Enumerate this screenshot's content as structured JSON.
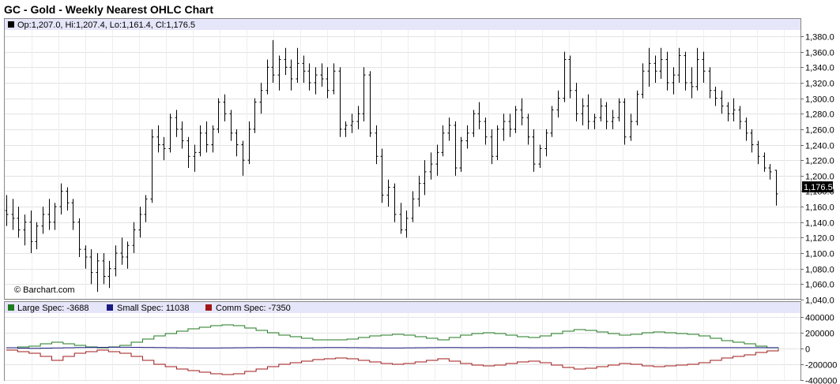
{
  "page_title": "GC - Gold - Weekly Nearest OHLC Chart",
  "colors": {
    "panel_border": "#888888",
    "info_strip": "#e6e6fa",
    "grid": "#e0e0e0",
    "bar": "#000000",
    "large_spec": "#1f7a1f",
    "small_spec": "#1a1a80",
    "comm_spec": "#a01818"
  },
  "chart_data": [
    {
      "type": "ohlc",
      "title": "GC - Gold - Weekly Nearest OHLC Chart",
      "info_line": "Op:1,207.0, Hi:1,207.4, Lo:1,161.4, Cl:1,176.5",
      "last_price_label": "1,176.5",
      "last_price": 1176.5,
      "watermark": "© Barchart.com",
      "ylim": [
        1040,
        1380
      ],
      "yticks": [
        1040,
        1060,
        1080,
        1100,
        1120,
        1140,
        1160,
        1180,
        1200,
        1220,
        1240,
        1260,
        1280,
        1300,
        1320,
        1340,
        1360,
        1380
      ],
      "ytick_labels": [
        "1,040.0",
        "1,060.0",
        "1,080.0",
        "1,100.0",
        "1,120.0",
        "1,140.0",
        "1,160.0",
        "1,180.0",
        "1,200.0",
        "1,220.0",
        "1,240.0",
        "1,260.0",
        "1,280.0",
        "1,300.0",
        "1,320.0",
        "1,340.0",
        "1,360.0",
        "1,380.0"
      ],
      "grid": true,
      "bars": [
        [
          1155,
          1175,
          1135,
          1150
        ],
        [
          1150,
          1170,
          1130,
          1145
        ],
        [
          1145,
          1160,
          1120,
          1130
        ],
        [
          1130,
          1150,
          1110,
          1140
        ],
        [
          1140,
          1155,
          1100,
          1115
        ],
        [
          1115,
          1140,
          1105,
          1135
        ],
        [
          1135,
          1160,
          1125,
          1150
        ],
        [
          1150,
          1170,
          1130,
          1140
        ],
        [
          1140,
          1165,
          1130,
          1160
        ],
        [
          1160,
          1190,
          1150,
          1180
        ],
        [
          1180,
          1185,
          1155,
          1165
        ],
        [
          1165,
          1170,
          1130,
          1140
        ],
        [
          1140,
          1145,
          1095,
          1105
        ],
        [
          1105,
          1110,
          1080,
          1095
        ],
        [
          1095,
          1105,
          1060,
          1075
        ],
        [
          1075,
          1100,
          1050,
          1090
        ],
        [
          1090,
          1100,
          1060,
          1070
        ],
        [
          1070,
          1090,
          1055,
          1080
        ],
        [
          1080,
          1110,
          1070,
          1100
        ],
        [
          1100,
          1120,
          1085,
          1095
        ],
        [
          1095,
          1115,
          1080,
          1110
        ],
        [
          1110,
          1140,
          1100,
          1130
        ],
        [
          1130,
          1160,
          1120,
          1150
        ],
        [
          1150,
          1175,
          1140,
          1170
        ],
        [
          1170,
          1260,
          1165,
          1250
        ],
        [
          1250,
          1265,
          1230,
          1240
        ],
        [
          1240,
          1250,
          1220,
          1235
        ],
        [
          1235,
          1280,
          1230,
          1275
        ],
        [
          1275,
          1285,
          1250,
          1260
        ],
        [
          1260,
          1270,
          1235,
          1245
        ],
        [
          1245,
          1250,
          1210,
          1225
        ],
        [
          1225,
          1240,
          1205,
          1230
        ],
        [
          1230,
          1265,
          1225,
          1255
        ],
        [
          1255,
          1270,
          1230,
          1240
        ],
        [
          1240,
          1265,
          1230,
          1260
        ],
        [
          1260,
          1300,
          1255,
          1295
        ],
        [
          1295,
          1305,
          1270,
          1280
        ],
        [
          1280,
          1285,
          1245,
          1255
        ],
        [
          1255,
          1260,
          1225,
          1240
        ],
        [
          1240,
          1245,
          1200,
          1220
        ],
        [
          1220,
          1270,
          1215,
          1260
        ],
        [
          1260,
          1300,
          1255,
          1295
        ],
        [
          1295,
          1320,
          1280,
          1310
        ],
        [
          1310,
          1350,
          1305,
          1340
        ],
        [
          1340,
          1375,
          1320,
          1330
        ],
        [
          1330,
          1355,
          1310,
          1350
        ],
        [
          1350,
          1365,
          1330,
          1340
        ],
        [
          1340,
          1350,
          1310,
          1325
        ],
        [
          1325,
          1365,
          1320,
          1345
        ],
        [
          1345,
          1355,
          1320,
          1335
        ],
        [
          1335,
          1345,
          1310,
          1320
        ],
        [
          1320,
          1340,
          1305,
          1330
        ],
        [
          1330,
          1345,
          1315,
          1325
        ],
        [
          1325,
          1340,
          1300,
          1310
        ],
        [
          1310,
          1345,
          1305,
          1335
        ],
        [
          1335,
          1340,
          1250,
          1260
        ],
        [
          1260,
          1270,
          1250,
          1265
        ],
        [
          1265,
          1280,
          1255,
          1270
        ],
        [
          1270,
          1290,
          1260,
          1280
        ],
        [
          1280,
          1340,
          1270,
          1330
        ],
        [
          1330,
          1335,
          1250,
          1255
        ],
        [
          1255,
          1265,
          1215,
          1225
        ],
        [
          1225,
          1235,
          1165,
          1175
        ],
        [
          1175,
          1195,
          1160,
          1185
        ],
        [
          1185,
          1190,
          1140,
          1150
        ],
        [
          1150,
          1165,
          1125,
          1130
        ],
        [
          1130,
          1155,
          1120,
          1145
        ],
        [
          1145,
          1180,
          1140,
          1170
        ],
        [
          1170,
          1200,
          1160,
          1190
        ],
        [
          1190,
          1220,
          1175,
          1205
        ],
        [
          1205,
          1230,
          1195,
          1215
        ],
        [
          1215,
          1240,
          1200,
          1230
        ],
        [
          1230,
          1265,
          1225,
          1255
        ],
        [
          1255,
          1275,
          1245,
          1265
        ],
        [
          1265,
          1270,
          1200,
          1210
        ],
        [
          1210,
          1250,
          1205,
          1245
        ],
        [
          1245,
          1265,
          1235,
          1255
        ],
        [
          1255,
          1285,
          1250,
          1280
        ],
        [
          1280,
          1295,
          1260,
          1270
        ],
        [
          1270,
          1275,
          1240,
          1250
        ],
        [
          1250,
          1260,
          1215,
          1225
        ],
        [
          1225,
          1265,
          1220,
          1260
        ],
        [
          1260,
          1280,
          1245,
          1270
        ],
        [
          1270,
          1280,
          1250,
          1260
        ],
        [
          1260,
          1290,
          1255,
          1285
        ],
        [
          1285,
          1300,
          1265,
          1275
        ],
        [
          1275,
          1280,
          1240,
          1250
        ],
        [
          1250,
          1260,
          1205,
          1215
        ],
        [
          1215,
          1240,
          1210,
          1235
        ],
        [
          1235,
          1260,
          1225,
          1255
        ],
        [
          1255,
          1290,
          1250,
          1285
        ],
        [
          1285,
          1310,
          1275,
          1300
        ],
        [
          1300,
          1360,
          1295,
          1350
        ],
        [
          1350,
          1355,
          1300,
          1310
        ],
        [
          1310,
          1320,
          1270,
          1280
        ],
        [
          1280,
          1300,
          1265,
          1290
        ],
        [
          1290,
          1305,
          1260,
          1270
        ],
        [
          1270,
          1280,
          1260,
          1275
        ],
        [
          1275,
          1300,
          1270,
          1290
        ],
        [
          1290,
          1295,
          1260,
          1270
        ],
        [
          1270,
          1285,
          1260,
          1275
        ],
        [
          1275,
          1300,
          1270,
          1295
        ],
        [
          1295,
          1300,
          1240,
          1250
        ],
        [
          1250,
          1280,
          1245,
          1270
        ],
        [
          1270,
          1310,
          1265,
          1305
        ],
        [
          1305,
          1345,
          1300,
          1335
        ],
        [
          1335,
          1365,
          1315,
          1345
        ],
        [
          1345,
          1355,
          1320,
          1335
        ],
        [
          1335,
          1365,
          1325,
          1350
        ],
        [
          1350,
          1360,
          1310,
          1320
        ],
        [
          1320,
          1340,
          1305,
          1330
        ],
        [
          1330,
          1365,
          1320,
          1355
        ],
        [
          1355,
          1360,
          1310,
          1320
        ],
        [
          1320,
          1340,
          1300,
          1315
        ],
        [
          1315,
          1365,
          1310,
          1350
        ],
        [
          1350,
          1360,
          1320,
          1335
        ],
        [
          1335,
          1340,
          1300,
          1310
        ],
        [
          1310,
          1315,
          1290,
          1300
        ],
        [
          1300,
          1310,
          1280,
          1290
        ],
        [
          1290,
          1295,
          1270,
          1280
        ],
        [
          1280,
          1300,
          1270,
          1285
        ],
        [
          1285,
          1290,
          1260,
          1270
        ],
        [
          1270,
          1275,
          1245,
          1255
        ],
        [
          1255,
          1260,
          1230,
          1240
        ],
        [
          1240,
          1245,
          1215,
          1225
        ],
        [
          1225,
          1230,
          1205,
          1210
        ],
        [
          1210,
          1215,
          1195,
          1205
        ],
        [
          1207,
          1207.4,
          1161.4,
          1176.5
        ]
      ]
    },
    {
      "type": "line",
      "legend": [
        "Large Spec: -3688",
        "Small Spec: 11038",
        "Comm Spec: -7350"
      ],
      "ylim": [
        -400000,
        400000
      ],
      "yticks": [
        -400000,
        -200000,
        0,
        200000,
        400000
      ],
      "ytick_labels": [
        "-400000",
        "-200000",
        "0",
        "200000",
        "400000"
      ],
      "series": [
        {
          "name": "Large Spec",
          "values": [
            10000,
            20000,
            30000,
            60000,
            80000,
            60000,
            40000,
            20000,
            10000,
            20000,
            40000,
            80000,
            120000,
            160000,
            190000,
            220000,
            250000,
            270000,
            290000,
            300000,
            290000,
            260000,
            230000,
            200000,
            170000,
            150000,
            130000,
            110000,
            110000,
            110000,
            120000,
            140000,
            160000,
            170000,
            180000,
            170000,
            150000,
            130000,
            110000,
            140000,
            170000,
            190000,
            200000,
            190000,
            170000,
            150000,
            140000,
            160000,
            190000,
            220000,
            240000,
            230000,
            210000,
            190000,
            170000,
            180000,
            200000,
            210000,
            200000,
            190000,
            180000,
            160000,
            130000,
            100000,
            80000,
            60000,
            30000,
            10000,
            -3688
          ]
        },
        {
          "name": "Small Spec",
          "values": [
            10000,
            5000,
            2000,
            5000,
            8000,
            10000,
            12000,
            14000,
            15000,
            16000,
            16000,
            15000,
            14000,
            12000,
            10000,
            9000,
            8000,
            8000,
            8000,
            9000,
            10000,
            11000,
            12000,
            12000,
            11000,
            10000,
            10000,
            11000,
            12000,
            12000,
            11000,
            10000,
            9000,
            8000,
            8000,
            9000,
            10000,
            11000,
            12000,
            12000,
            11000,
            11000,
            12000,
            13000,
            12000,
            11000,
            10000,
            10000,
            11000,
            12000,
            12000,
            11000,
            10000,
            10000,
            11000,
            12000,
            12000,
            11000,
            10000,
            10000,
            11000,
            11000,
            11000,
            11000,
            11000,
            11000,
            11000,
            11000,
            11038
          ]
        },
        {
          "name": "Comm Spec",
          "values": [
            -20000,
            -40000,
            -60000,
            -100000,
            -150000,
            -100000,
            -60000,
            -40000,
            -20000,
            -40000,
            -60000,
            -100000,
            -150000,
            -200000,
            -230000,
            -260000,
            -280000,
            -300000,
            -320000,
            -330000,
            -320000,
            -290000,
            -260000,
            -230000,
            -200000,
            -180000,
            -160000,
            -140000,
            -130000,
            -120000,
            -130000,
            -150000,
            -170000,
            -190000,
            -200000,
            -190000,
            -170000,
            -150000,
            -130000,
            -160000,
            -190000,
            -210000,
            -220000,
            -210000,
            -190000,
            -170000,
            -160000,
            -180000,
            -210000,
            -240000,
            -260000,
            -250000,
            -230000,
            -210000,
            -190000,
            -200000,
            -220000,
            -230000,
            -220000,
            -210000,
            -200000,
            -180000,
            -150000,
            -120000,
            -100000,
            -80000,
            -50000,
            -30000,
            -7350
          ]
        }
      ]
    }
  ]
}
